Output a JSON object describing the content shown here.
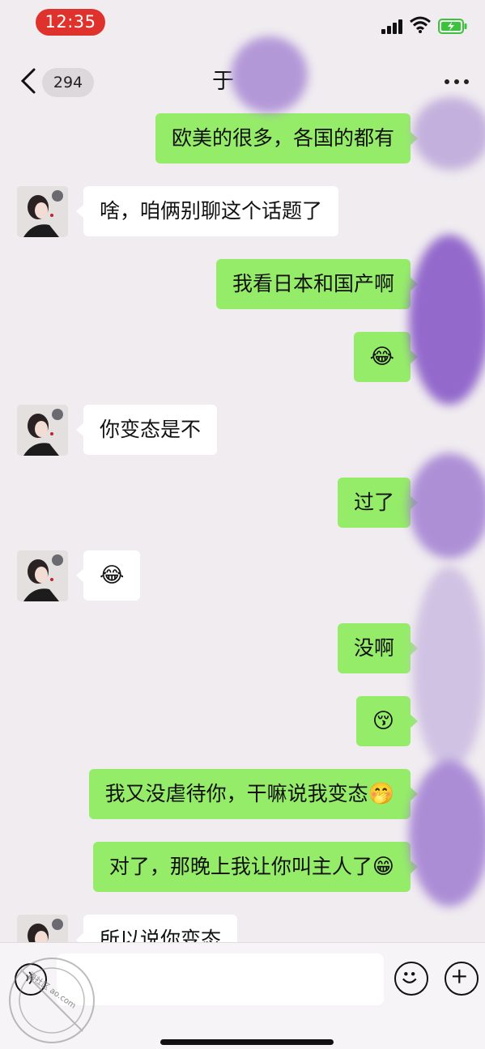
{
  "status_bar": {
    "time": "12:35",
    "time_pill_color": "#e0322c",
    "battery_color": "#3cc23c"
  },
  "nav": {
    "back_icon": "chevron-left-icon",
    "unread_count": "294",
    "title": "于",
    "more_icon": "more-dots-icon"
  },
  "messages": [
    {
      "side": "out",
      "text": "欧美的很多，各国的都有",
      "emoji": ""
    },
    {
      "side": "in",
      "text": "啥，咱俩别聊这个话题了",
      "emoji": ""
    },
    {
      "side": "out",
      "text": "我看日本和国产啊",
      "emoji": ""
    },
    {
      "side": "out",
      "text": "",
      "emoji": "😂"
    },
    {
      "side": "in",
      "text": "你变态是不",
      "emoji": ""
    },
    {
      "side": "out",
      "text": "过了",
      "emoji": ""
    },
    {
      "side": "in",
      "text": "",
      "emoji": "😂"
    },
    {
      "side": "out",
      "text": "没啊",
      "emoji": ""
    },
    {
      "side": "out",
      "text": "",
      "emoji": "😚"
    },
    {
      "side": "out",
      "text": "我又没虐待你，干嘛说我变态",
      "emoji": "🤭"
    },
    {
      "side": "out",
      "text": "对了，那晚上我让你叫主人了",
      "emoji": "😁"
    },
    {
      "side": "in",
      "text": "所以说你变态",
      "emoji": ""
    }
  ],
  "colors": {
    "outgoing_bubble": "#95ec69",
    "incoming_bubble": "#ffffff",
    "background": "#f0ecf0",
    "redaction": "#8a5cc8"
  },
  "input_bar": {
    "voice_icon": "voice-icon",
    "emoji_icon": "smiley-icon",
    "plus_icon": "plus-icon",
    "placeholder": ""
  },
  "watermark": {
    "text": "海社区 ao.com"
  }
}
